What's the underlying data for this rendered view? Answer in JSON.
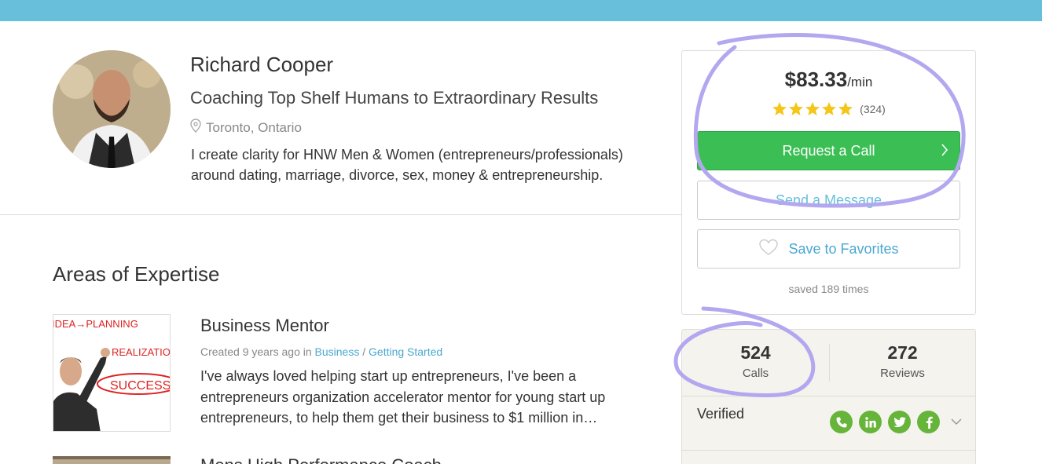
{
  "profile": {
    "name": "Richard Cooper",
    "tagline": "Coaching Top Shelf Humans to Extraordinary Results",
    "location": "Toronto, Ontario",
    "bio_line1": "I create clarity for HNW Men & Women (entrepreneurs/professionals)",
    "bio_line2": "around dating, marriage, divorce, sex, money & entrepreneurship."
  },
  "expertise": {
    "section_title": "Areas of Expertise",
    "items": [
      {
        "title": "Business Mentor",
        "meta_prefix": "Created 9 years ago in",
        "category": "Business",
        "separator": " / ",
        "subcategory": "Getting Started",
        "desc_line1": "I've always loved helping start up entrepreneurs, I've been a",
        "desc_line2": "entrepreneurs organization accelerator mentor for young start up",
        "desc_line3": "entrepreneurs, to help them get their business to $1 million in…",
        "image_text": {
          "line1": "IDEA→PLANNING",
          "line2": "REALIZATION",
          "line3": "SUCCESS"
        }
      },
      {
        "title": "Mens High Performance Coach"
      }
    ]
  },
  "pricing": {
    "amount": "$83.33",
    "unit": "/min",
    "rating_stars": 5,
    "rating_count": "(324)",
    "request_call_label": "Request a Call",
    "send_message_label": "Send a Message",
    "save_favorites_label": "Save to Favorites",
    "saved_count_text": "saved 189 times"
  },
  "stats": {
    "calls_value": "524",
    "calls_label": "Calls",
    "reviews_value": "272",
    "reviews_label": "Reviews",
    "verified_label": "Verified",
    "verified_icons": [
      "phone-icon",
      "linkedin-icon",
      "twitter-icon",
      "facebook-icon"
    ]
  },
  "colors": {
    "top_bar": "#67bfdb",
    "call_button": "#3bbf55",
    "link": "#4aa8d0",
    "star": "#f5c518",
    "verified_badge": "#66b53a",
    "annotation": "#b3a7ef"
  }
}
